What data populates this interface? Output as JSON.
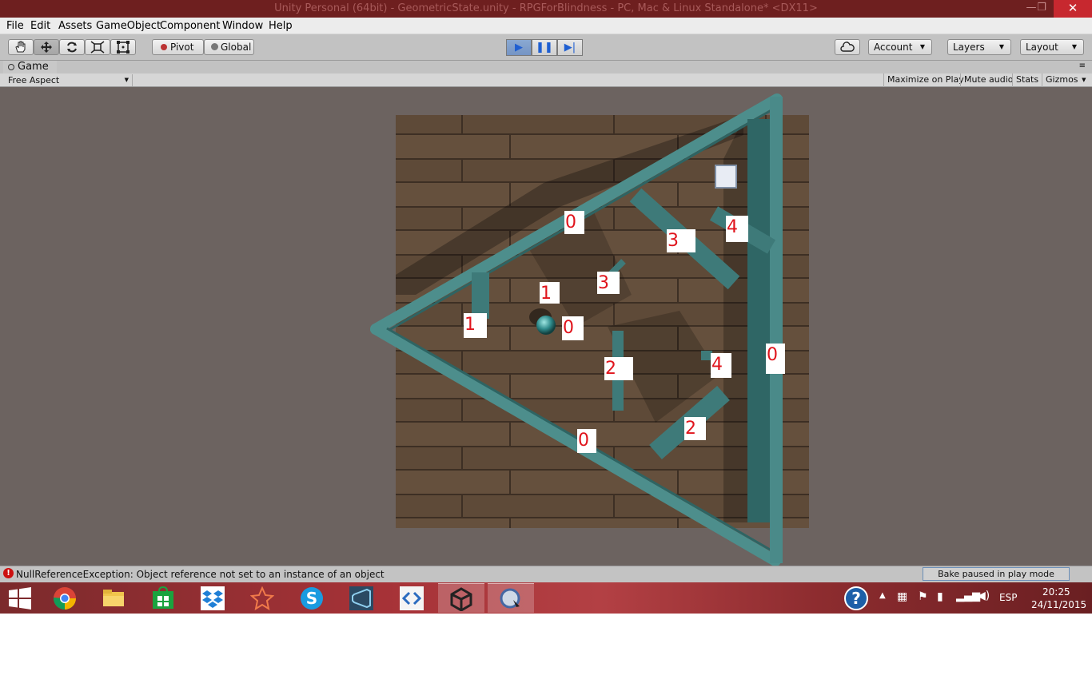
{
  "window": {
    "title": "Unity Personal (64bit) - GeometricState.unity - RPGForBlindness - PC, Mac & Linux Standalone* <DX11>",
    "minimize": "—",
    "maximize": "❐",
    "close": "✕"
  },
  "menu": [
    "File",
    "Edit",
    "Assets",
    "GameObject",
    "Component",
    "Window",
    "Help"
  ],
  "toolbar": {
    "pivot": "Pivot",
    "global": "Global",
    "account": "Account",
    "layers": "Layers",
    "layout": "Layout"
  },
  "game_panel": {
    "tab": "Game",
    "aspect": "Free Aspect",
    "maximize_on_play": "Maximize on Play",
    "mute_audio": "Mute audio",
    "stats": "Stats",
    "gizmos": "Gizmos"
  },
  "scene_labels": [
    {
      "name": "label-0-top-wall",
      "text": "0"
    },
    {
      "name": "label-3-upper-right",
      "text": "3"
    },
    {
      "name": "label-4-upper-right",
      "text": "4"
    },
    {
      "name": "label-3-center",
      "text": "3"
    },
    {
      "name": "label-1-center",
      "text": "1"
    },
    {
      "name": "label-1-left",
      "text": "1"
    },
    {
      "name": "label-0-ball",
      "text": "0"
    },
    {
      "name": "label-0-right-wall",
      "text": "0"
    },
    {
      "name": "label-2-center",
      "text": "2"
    },
    {
      "name": "label-4-lower-right",
      "text": "4"
    },
    {
      "name": "label-2-lower",
      "text": "2"
    },
    {
      "name": "label-0-bottom-wall",
      "text": "0"
    }
  ],
  "status": {
    "error": "NullReferenceException: Object reference not set to an instance of an object",
    "bake": "Bake paused in play mode"
  },
  "taskbar": {
    "language": "ESP",
    "time": "20:25",
    "date": "24/11/2015"
  }
}
